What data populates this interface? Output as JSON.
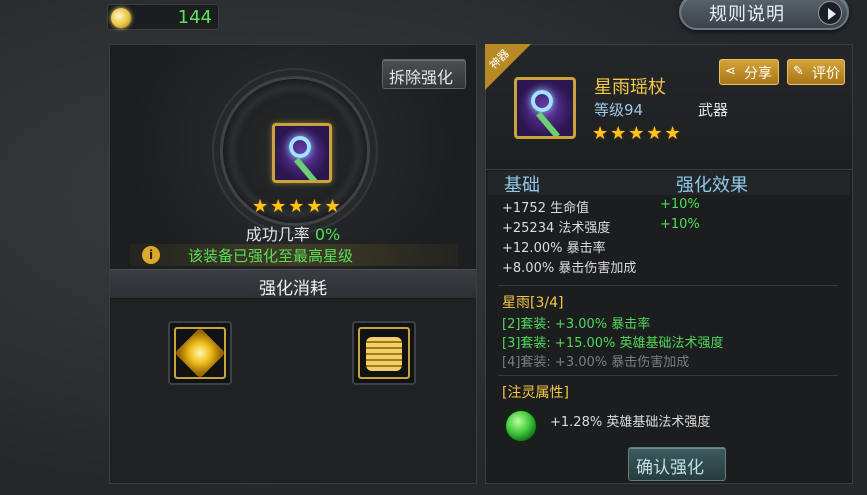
{
  "currency": {
    "value": "144",
    "icon": "gold-coin-icon"
  },
  "header": {
    "rules_label": "规则说明",
    "rules_icon": "play-arrow-icon"
  },
  "left": {
    "remove_label": "拆除强化",
    "item_icon": "staff-icon",
    "stars": "★★★★★",
    "star_count": 5,
    "success_label": "成功几率",
    "success_value": "0%",
    "info_text": "该装备已强化至最高星级",
    "cost_title": "强化消耗",
    "cost_items": [
      {
        "icon": "enhance-stone-icon"
      },
      {
        "icon": "gold-coins-icon"
      }
    ]
  },
  "right": {
    "badge": "神器",
    "item_name": "星雨瑶杖",
    "level_label": "等级94",
    "item_type": "武器",
    "stars": "★★★★★",
    "star_count": 5,
    "share_label": "分享",
    "review_label": "评价",
    "base_header": "基础",
    "enh_header": "强化效果",
    "stats": [
      {
        "text": "+1752 生命值",
        "bonus": "+10%"
      },
      {
        "text": "+25234 法术强度",
        "bonus": "+10%"
      },
      {
        "text": "+12.00% 暴击率",
        "bonus": ""
      },
      {
        "text": "+8.00% 暴击伤害加成",
        "bonus": ""
      }
    ],
    "set_title": "星雨[3/4]",
    "set_lines": [
      {
        "text": "[2]套装: +3.00% 暴击率",
        "active": true
      },
      {
        "text": "[3]套装: +15.00% 英雄基础法术强度",
        "active": true
      },
      {
        "text": "[4]套装: +3.00% 暴击伤害加成",
        "active": false
      }
    ],
    "spirit_title": "[注灵属性]",
    "spirit_text": "+1.28% 英雄基础法术强度",
    "confirm_label": "确认强化"
  },
  "colors": {
    "accent_gold": "#f5c845",
    "positive_green": "#4fe055",
    "label_blue": "#8fc7e6"
  }
}
